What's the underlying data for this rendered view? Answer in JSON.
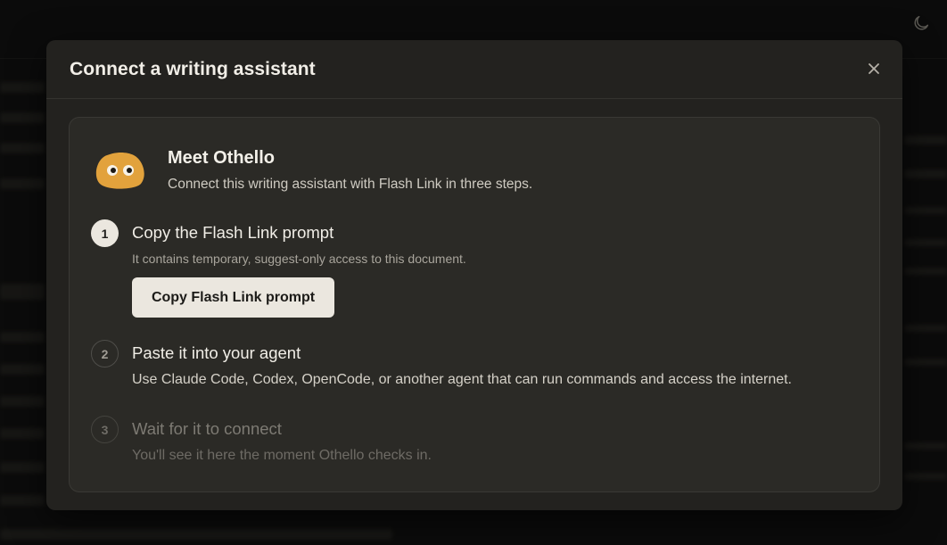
{
  "background": {
    "theme_toggle_icon": "moon-icon"
  },
  "modal": {
    "title": "Connect a writing assistant",
    "close_icon": "close-icon"
  },
  "intro": {
    "avatar_icon": "othello-blob-avatar",
    "name": "Meet Othello",
    "subtitle": "Connect this writing assistant with Flash Link in three steps."
  },
  "steps": [
    {
      "number": "1",
      "title": "Copy the Flash Link prompt",
      "description": "It contains temporary, suggest-only access to this document.",
      "button_label": "Copy Flash Link prompt",
      "state": "active"
    },
    {
      "number": "2",
      "title": "Paste it into your agent",
      "description": "Use Claude Code, Codex, OpenCode, or another agent that can run commands and access the internet.",
      "state": "pending"
    },
    {
      "number": "3",
      "title": "Wait for it to connect",
      "description": "You'll see it here the moment Othello checks in.",
      "state": "disabled"
    }
  ],
  "colors": {
    "modal_bg": "#23221f",
    "card_bg": "#2b2a26",
    "accent_button": "#ebe7df",
    "avatar": "#e2a23c"
  }
}
